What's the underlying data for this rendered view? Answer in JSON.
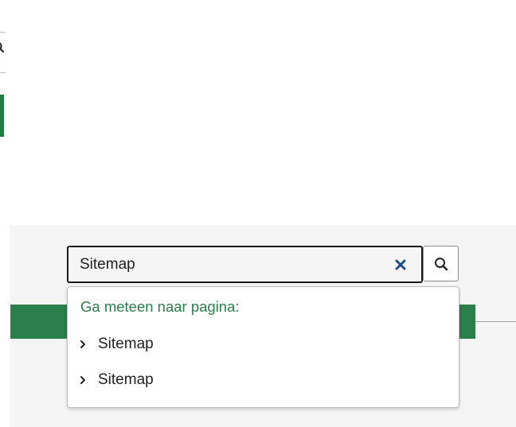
{
  "search": {
    "value": "Sitemap",
    "placeholder": "",
    "clear_icon": "close-icon",
    "submit_icon": "search-icon"
  },
  "dropdown": {
    "heading": "Ga meteen naar pagina:",
    "items": [
      {
        "label": "Sitemap",
        "icon": "chevron-right-icon"
      },
      {
        "label": "Sitemap",
        "icon": "chevron-right-icon"
      }
    ]
  },
  "colors": {
    "accent_green": "#2a7f4a",
    "clear_icon_blue": "#1f4e8c",
    "band_grey": "#f5f5f5"
  }
}
